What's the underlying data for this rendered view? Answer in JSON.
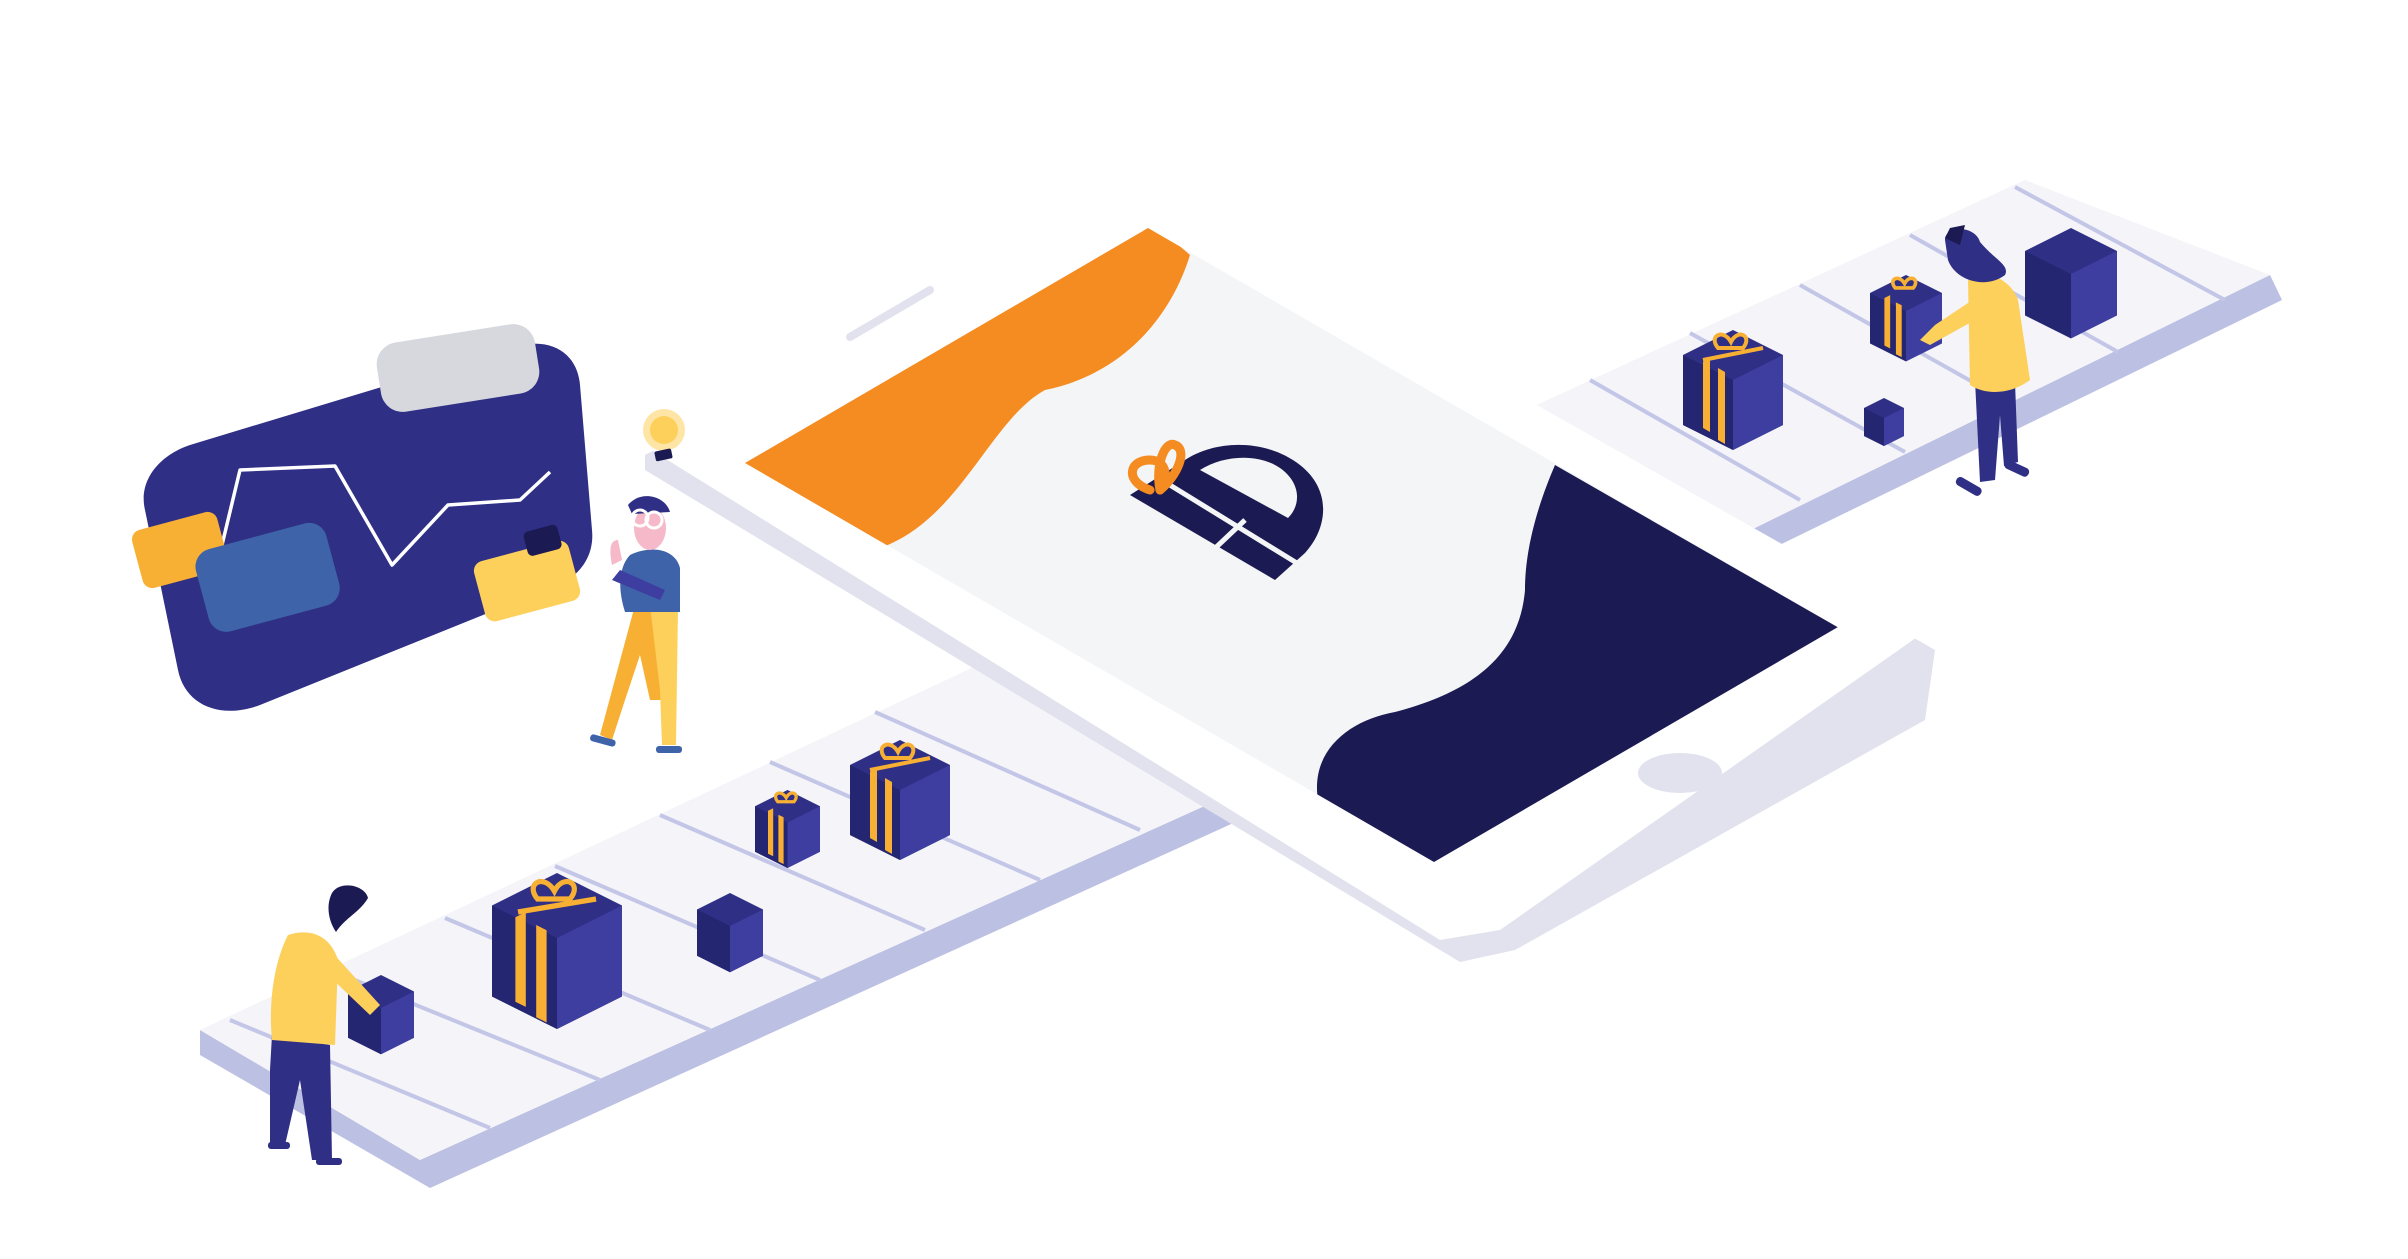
{
  "colors": {
    "background": "#ffffff",
    "belt_top": "#f4f4f9",
    "belt_side": "#bcc0e2",
    "belt_slat": "#c3c6e6",
    "phone_body": "#ffffff",
    "phone_edge": "#e2e2ee",
    "screen_bg": "#f4f5f7",
    "orange": "#f58c21",
    "navy": "#1c1a52",
    "indigo": "#2e2f85",
    "indigo_dark": "#252672",
    "indigo_light": "#3d3ea0",
    "yellow": "#fdd05b",
    "gold": "#f7b034",
    "gray_card": "#d7d8de",
    "steel_blue": "#3f63a9",
    "skin": "#f6b9c9",
    "home_button": "#e1e2ee"
  },
  "icons": {
    "logo": "gift-bow-logo-icon",
    "chart_card": "wallet-chart-card-icon",
    "lightbulb": "lightbulb-icon"
  }
}
